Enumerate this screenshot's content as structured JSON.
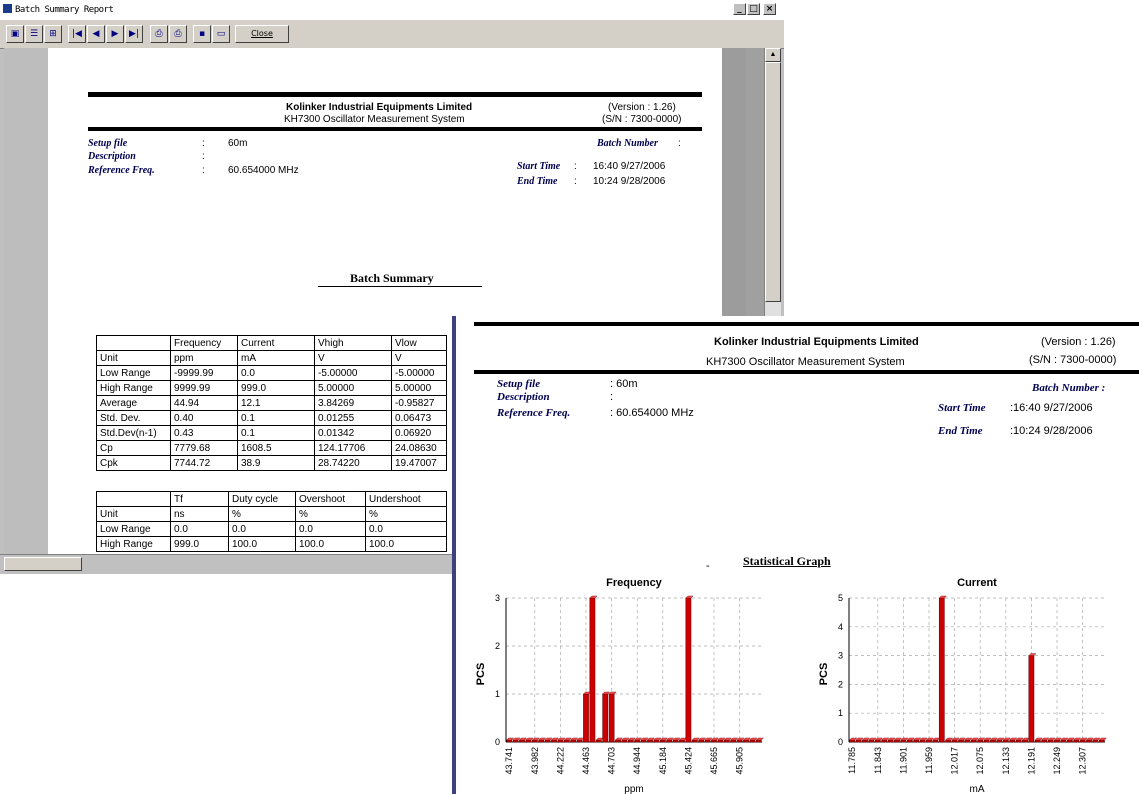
{
  "window": {
    "title": "Batch Summary Report",
    "close_label": "Close",
    "controls": [
      "_",
      "□",
      "×"
    ]
  },
  "report": {
    "company": "Kolinker Industrial Equipments Limited",
    "system": "KH7300 Oscillator Measurement System",
    "version": "(Version : 1.26)",
    "serial": "(S/N : 7300-0000)",
    "setup_file_label": "Setup file",
    "setup_file_value": "60m",
    "description_label": "Description",
    "reference_label": "Reference Freq.",
    "reference_value": "60.654000 MHz",
    "batch_number_label": "Batch Number",
    "start_time_label": "Start Time",
    "start_time_value": "16:40   9/27/2006",
    "end_time_label": "End Time",
    "end_time_value": "10:24   9/28/2006",
    "colon": ":",
    "batch_summary": "Batch Summary"
  },
  "table1": {
    "headers": [
      "",
      "Frequency",
      "Current",
      "Vhigh",
      "Vlow"
    ],
    "rows": [
      [
        "Unit",
        "ppm",
        "mA",
        "V",
        "V"
      ],
      [
        "Low Range",
        "-9999.99",
        "0.0",
        "-5.00000",
        "-5.00000"
      ],
      [
        "High Range",
        "9999.99",
        "999.0",
        "5.00000",
        "5.00000"
      ],
      [
        "Average",
        "44.94",
        "12.1",
        "3.84269",
        "-0.95827"
      ],
      [
        "Std. Dev.",
        "0.40",
        "0.1",
        "0.01255",
        "0.06473"
      ],
      [
        "Std.Dev(n-1)",
        "0.43",
        "0.1",
        "0.01342",
        "0.06920"
      ],
      [
        "Cp",
        "7779.68",
        "1608.5",
        "124.17706",
        "24.08630"
      ],
      [
        "Cpk",
        "7744.72",
        "38.9",
        "28.74220",
        "19.47007"
      ]
    ]
  },
  "table2": {
    "headers": [
      "",
      "Tf",
      "Duty cycle",
      "Overshoot",
      "Undershoot"
    ],
    "rows": [
      [
        "Unit",
        "ns",
        "%",
        "%",
        "%"
      ],
      [
        "Low Range",
        "0.0",
        "0.0",
        "0.0",
        "0.0"
      ],
      [
        "High Range",
        "999.0",
        "100.0",
        "100.0",
        "100.0"
      ]
    ]
  },
  "overlay": {
    "company": "Kolinker Industrial Equipments Limited",
    "system": "KH7300 Oscillator Measurement System",
    "version": "(Version : 1.26)",
    "serial": "(S/N : 7300-0000)",
    "setup_file_label": "Setup file",
    "setup_file_value": ": 60m",
    "description_label": "Description",
    "reference_label": "Reference Freq.",
    "reference_value": ": 60.654000 MHz",
    "batch_number_label": "Batch Number :",
    "start_time_label": "Start Time",
    "start_time_value": ":16:40   9/27/2006",
    "end_time_label": "End Time",
    "end_time_value": ":10:24   9/28/2006",
    "colon": ":",
    "dash": "-",
    "graph_title": "Statistical Graph"
  },
  "chart_data": [
    {
      "type": "bar",
      "title": "Frequency",
      "xlabel": "ppm",
      "ylabel": "PCS",
      "ylim": [
        0,
        3
      ],
      "yticks": [
        "0",
        "1",
        "2",
        "3"
      ],
      "categories": [
        "43.741",
        "43.802",
        "43.862",
        "43.922",
        "43.982",
        "44.042",
        "44.102",
        "44.162",
        "44.222",
        "44.282",
        "44.342",
        "44.403",
        "44.463",
        "44.523",
        "44.583",
        "44.643",
        "44.703",
        "44.763",
        "44.823",
        "44.884",
        "44.944",
        "45.004",
        "45.064",
        "45.124",
        "45.184",
        "45.244",
        "45.304",
        "45.364",
        "45.424",
        "45.484",
        "45.545",
        "45.605",
        "45.665",
        "45.725",
        "45.785",
        "45.845",
        "45.905",
        "45.965",
        "46.025",
        "46.086"
      ],
      "values": [
        0,
        0,
        0,
        0,
        0,
        0,
        0,
        0,
        0,
        0,
        0,
        0,
        1,
        3,
        0,
        1,
        1,
        0,
        0,
        0,
        0,
        0,
        0,
        0,
        0,
        0,
        0,
        0,
        3,
        0,
        0,
        0,
        0,
        0,
        0,
        0,
        0,
        0,
        0,
        0
      ],
      "tick_labels": [
        "43.741",
        "43.982",
        "44.222",
        "44.463",
        "44.703",
        "44.944",
        "45.184",
        "45.424",
        "45.665",
        "45.905"
      ],
      "bar_color": "#cc0000",
      "grid": true
    },
    {
      "type": "bar",
      "title": "Current",
      "xlabel": "mA",
      "ylabel": "PCS",
      "ylim": [
        0,
        5
      ],
      "yticks": [
        "0",
        "1",
        "2",
        "3",
        "4",
        "5"
      ],
      "categories": [
        "11.785",
        "11.800",
        "11.814",
        "11.829",
        "11.843",
        "11.858",
        "11.872",
        "11.887",
        "11.901",
        "11.916",
        "11.930",
        "11.945",
        "11.959",
        "11.974",
        "11.988",
        "12.003",
        "12.017",
        "12.032",
        "12.046",
        "12.061",
        "12.075",
        "12.090",
        "12.104",
        "12.119",
        "12.133",
        "12.148",
        "12.162",
        "12.177",
        "12.191",
        "12.206",
        "12.220",
        "12.235",
        "12.249",
        "12.264",
        "12.278",
        "12.293",
        "12.307",
        "12.322",
        "12.336",
        "12.351"
      ],
      "values": [
        0,
        0,
        0,
        0,
        0,
        0,
        0,
        0,
        0,
        0,
        0,
        0,
        0,
        0,
        5,
        0,
        0,
        0,
        0,
        0,
        0,
        0,
        0,
        0,
        0,
        0,
        0,
        0,
        3,
        0,
        0,
        0,
        0,
        0,
        0,
        0,
        0,
        0,
        0,
        0
      ],
      "tick_labels": [
        "11.785",
        "11.843",
        "11.901",
        "11.959",
        "12.017",
        "12.075",
        "12.133",
        "12.191",
        "12.249",
        "12.307"
      ],
      "bar_color": "#cc0000",
      "grid": true
    }
  ]
}
